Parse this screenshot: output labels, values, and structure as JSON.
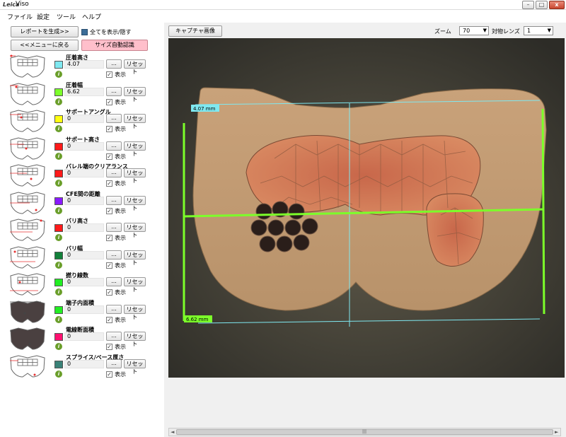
{
  "window": {
    "logo": "Leica",
    "title": "Viso",
    "min_label": "–",
    "max_label": "□",
    "close_label": "x"
  },
  "menu": [
    {
      "label": "ファイル"
    },
    {
      "label": "設定"
    },
    {
      "label": "ツール"
    },
    {
      "label": "ヘルプ"
    }
  ],
  "left": {
    "report_button": "レポートを生成>>",
    "show_all_label": "全てを表示/隠す",
    "back_button": "<<メニューに戻る",
    "auto_size_button": "サイズ自動認識",
    "dots_label": "...",
    "reset_label": "リセット",
    "show_label": "表示",
    "info_label": "i",
    "items": [
      {
        "label": "圧着高さ",
        "value": "4.07",
        "color": "#7fe8f0",
        "shown": true
      },
      {
        "label": "圧着幅",
        "value": "6.62",
        "color": "#7cff2a",
        "shown": true
      },
      {
        "label": "サポートアングル",
        "value": "0",
        "color": "#ffff10",
        "shown": true
      },
      {
        "label": "サポート高さ",
        "value": "0",
        "color": "#ff1a1a",
        "shown": true
      },
      {
        "label": "バレル端のクリアランス",
        "value": "0",
        "color": "#ff1a1a",
        "shown": true
      },
      {
        "label": "CFE間の距離",
        "value": "0",
        "color": "#8a1aff",
        "shown": true
      },
      {
        "label": "バリ高さ",
        "value": "0",
        "color": "#ff1a1a",
        "shown": true
      },
      {
        "label": "バリ幅",
        "value": "0",
        "color": "#12803a",
        "shown": true
      },
      {
        "label": "撚り線数",
        "value": "0",
        "color": "#22ee22",
        "shown": true
      },
      {
        "label": "端子内面積",
        "value": "0",
        "color": "#22ee22",
        "shown": true
      },
      {
        "label": "電線断面積",
        "value": "0",
        "color": "#ff1070",
        "shown": true
      },
      {
        "label": "スプライス/ベース厚さ",
        "value": "0",
        "color": "#3a8278",
        "shown": true
      }
    ]
  },
  "right": {
    "capture_button": "キャプチャ画像",
    "zoom_label": "ズーム",
    "zoom_value": "70",
    "objective_label": "対物レンズ",
    "objective_value": "1",
    "measure_height": "4.07 mm",
    "measure_width": "6.62 mm",
    "colors": {
      "height_line": "#7fe8f0",
      "width_line": "#7cff2a"
    }
  }
}
